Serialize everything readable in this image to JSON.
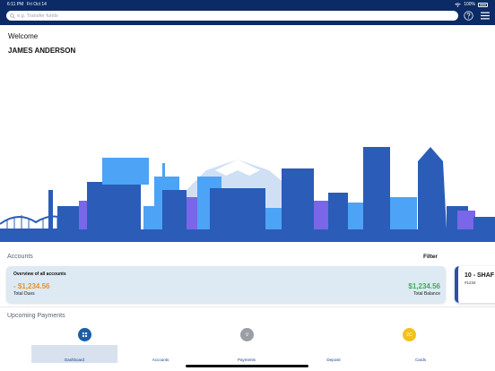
{
  "status_bar": {
    "time": "6:11 PM",
    "date": "Fri Oct 14",
    "battery_text": "100%",
    "battery_level": 1.0
  },
  "search": {
    "placeholder": "e.g. Transfer funds"
  },
  "icons": {
    "help": "help-icon",
    "menu": "hamburger-menu-icon",
    "search": "search-icon",
    "wifi": "wifi-icon",
    "battery": "battery-icon"
  },
  "greeting": {
    "welcome": "Welcome",
    "name": "JAMES ANDERSON"
  },
  "accounts": {
    "title": "Accounts",
    "filter_label": "Filter",
    "overview": {
      "title": "Overview of all accounts",
      "dues_value": "- $1,234.56",
      "dues_label": "Total Dues",
      "balance_value": "$1,234.56",
      "balance_label": "Total Balance"
    },
    "cards": [
      {
        "name": "10 - SHAF",
        "number": "#1234"
      }
    ]
  },
  "upcoming_payments": {
    "title": "Upcoming Payments",
    "payees": [
      {
        "label": "",
        "icon": "grid-icon"
      },
      {
        "label": "V"
      },
      {
        "label": "2C"
      }
    ]
  },
  "tabs": [
    {
      "label": "Dashboard",
      "active": true
    },
    {
      "label": "Accounts",
      "active": false
    },
    {
      "label": "Payments",
      "active": false
    },
    {
      "label": "Deposit",
      "active": false
    },
    {
      "label": "Cards",
      "active": false
    }
  ],
  "colors": {
    "header_bg": "#0b2a66",
    "dues": "#e8922c",
    "balance": "#37b24d",
    "skyline_dark": "#2a5cb8",
    "skyline_light": "#4da3f5",
    "skyline_violet": "#7a66e8",
    "active_tab_bg": "#d8e2ee"
  }
}
